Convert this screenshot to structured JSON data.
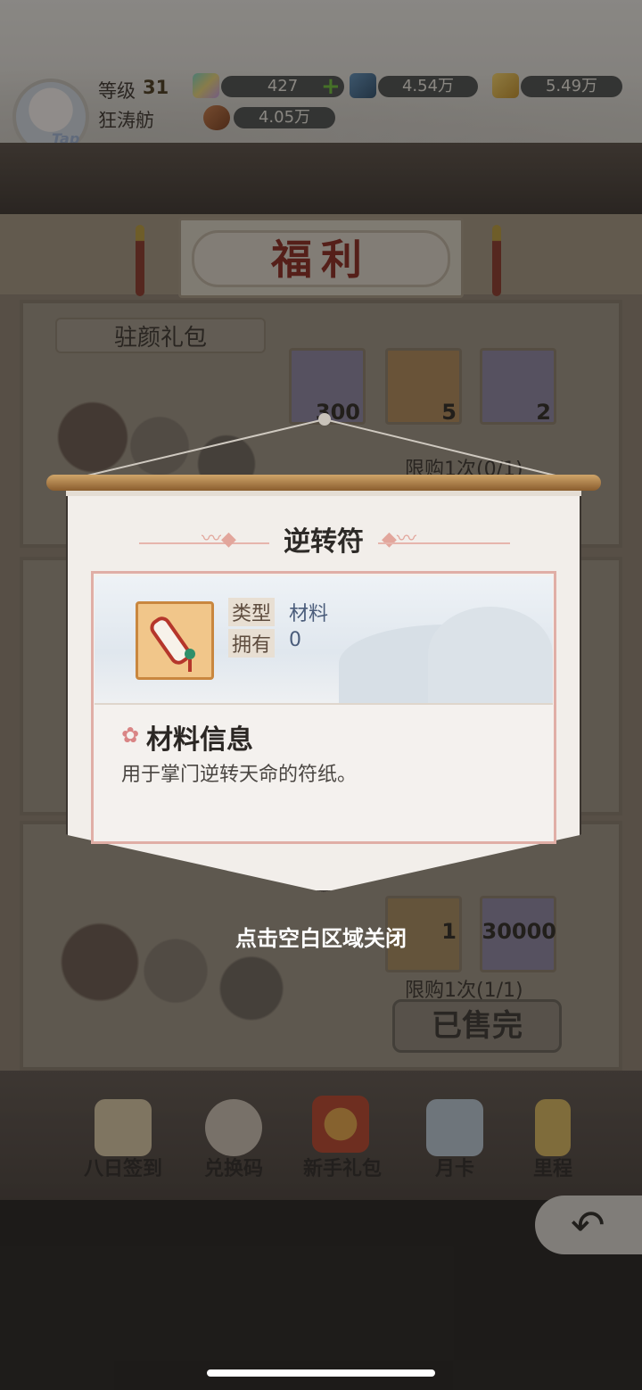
{
  "player": {
    "level_label": "等级",
    "level": "31",
    "name": "狂涛舫",
    "avatar_tag": "Tap"
  },
  "resources": [
    {
      "name": "spirit-crystal",
      "value": "427",
      "has_add": true,
      "add_symbol": "+"
    },
    {
      "name": "blue-gem",
      "value": "4.54万"
    },
    {
      "name": "gold-ingot",
      "value": "5.49万"
    },
    {
      "name": "meat",
      "value": "4.05万"
    }
  ],
  "page": {
    "title": "福利"
  },
  "shop": {
    "pack1": {
      "name": "驻颜礼包",
      "items": [
        {
          "icon": "rainbow-crystal-icon",
          "count": "300"
        },
        {
          "icon": "key-icon",
          "count": "5"
        },
        {
          "icon": "peach-icon",
          "count": "2"
        }
      ],
      "limit": "限购1次(0/1)"
    },
    "pack3": {
      "items": [
        {
          "icon": "item-icon",
          "count": "1"
        },
        {
          "icon": "ore-icon",
          "count": "30000"
        }
      ],
      "limit": "限购1次(1/1)",
      "soldout_label": "已售完"
    }
  },
  "nav": [
    {
      "label": "八日签到",
      "icon": "calendar-icon"
    },
    {
      "label": "兑换码",
      "icon": "character-icon"
    },
    {
      "label": "新手礼包",
      "icon": "gift-chest-icon"
    },
    {
      "label": "月卡",
      "icon": "month-card-icon"
    },
    {
      "label": "里程",
      "icon": "milestone-icon"
    }
  ],
  "back_symbol": "↶",
  "popup": {
    "title": "逆转符",
    "type_label": "类型",
    "type_value": "材料",
    "own_label": "拥有",
    "own_value": "0",
    "section_title": "材料信息",
    "section_icon": "✿",
    "description": "用于掌门逆转天命的符纸。",
    "item_icon": "scroll-icon"
  },
  "close_hint": "点击空白区域关闭",
  "colors": {
    "title_red": "#8a2a22",
    "popup_bg": "#f2eeea",
    "accent_pink": "#e0aea6",
    "value_blue": "#4a5c7a"
  }
}
